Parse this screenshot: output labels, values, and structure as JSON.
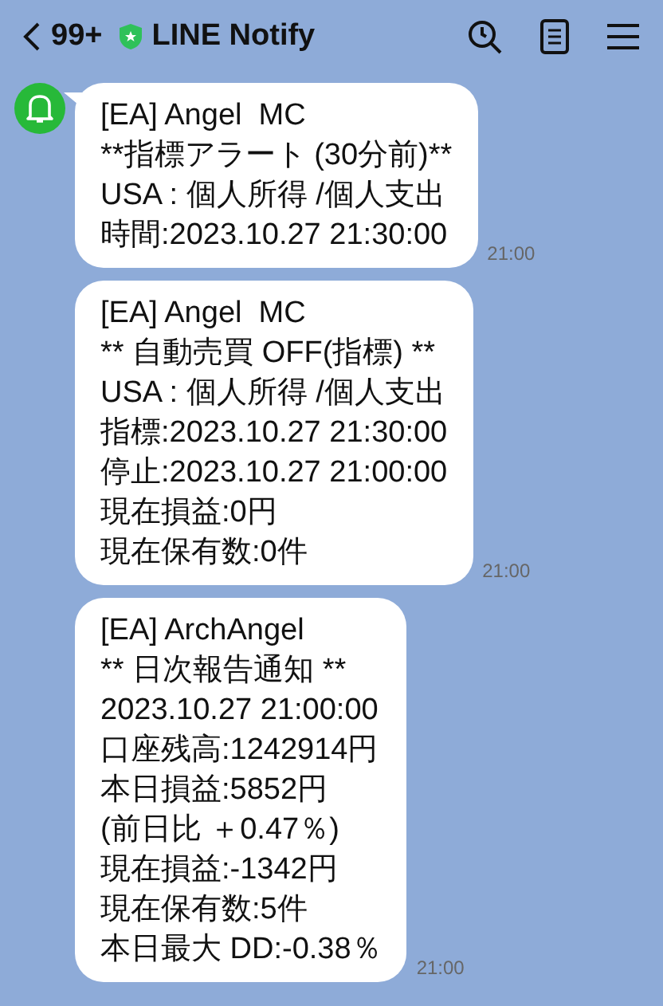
{
  "header": {
    "back_count": "99+",
    "title": "LINE Notify",
    "verified": true
  },
  "messages": [
    {
      "lines": [
        "[EA] Angel  MC",
        "**指標アラート (30分前)**",
        "USA : 個人所得 /個人支出",
        "時間:2023.10.27 21:30:00"
      ],
      "time": "21:00",
      "show_avatar": true
    },
    {
      "lines": [
        "[EA] Angel  MC",
        "** 自動売買 OFF(指標) **",
        "USA : 個人所得 /個人支出",
        "指標:2023.10.27 21:30:00",
        "停止:2023.10.27 21:00:00",
        "現在損益:0円",
        "現在保有数:0件"
      ],
      "time": "21:00",
      "show_avatar": false
    },
    {
      "lines": [
        "[EA] ArchAngel",
        "** 日次報告通知 **",
        "2023.10.27 21:00:00",
        "口座残高:1242914円",
        "本日損益:5852円",
        "(前日比 ＋0.47％)",
        "現在損益:-1342円",
        "現在保有数:5件",
        "本日最大 DD:-0.38％"
      ],
      "time": "21:00",
      "show_avatar": false
    }
  ]
}
